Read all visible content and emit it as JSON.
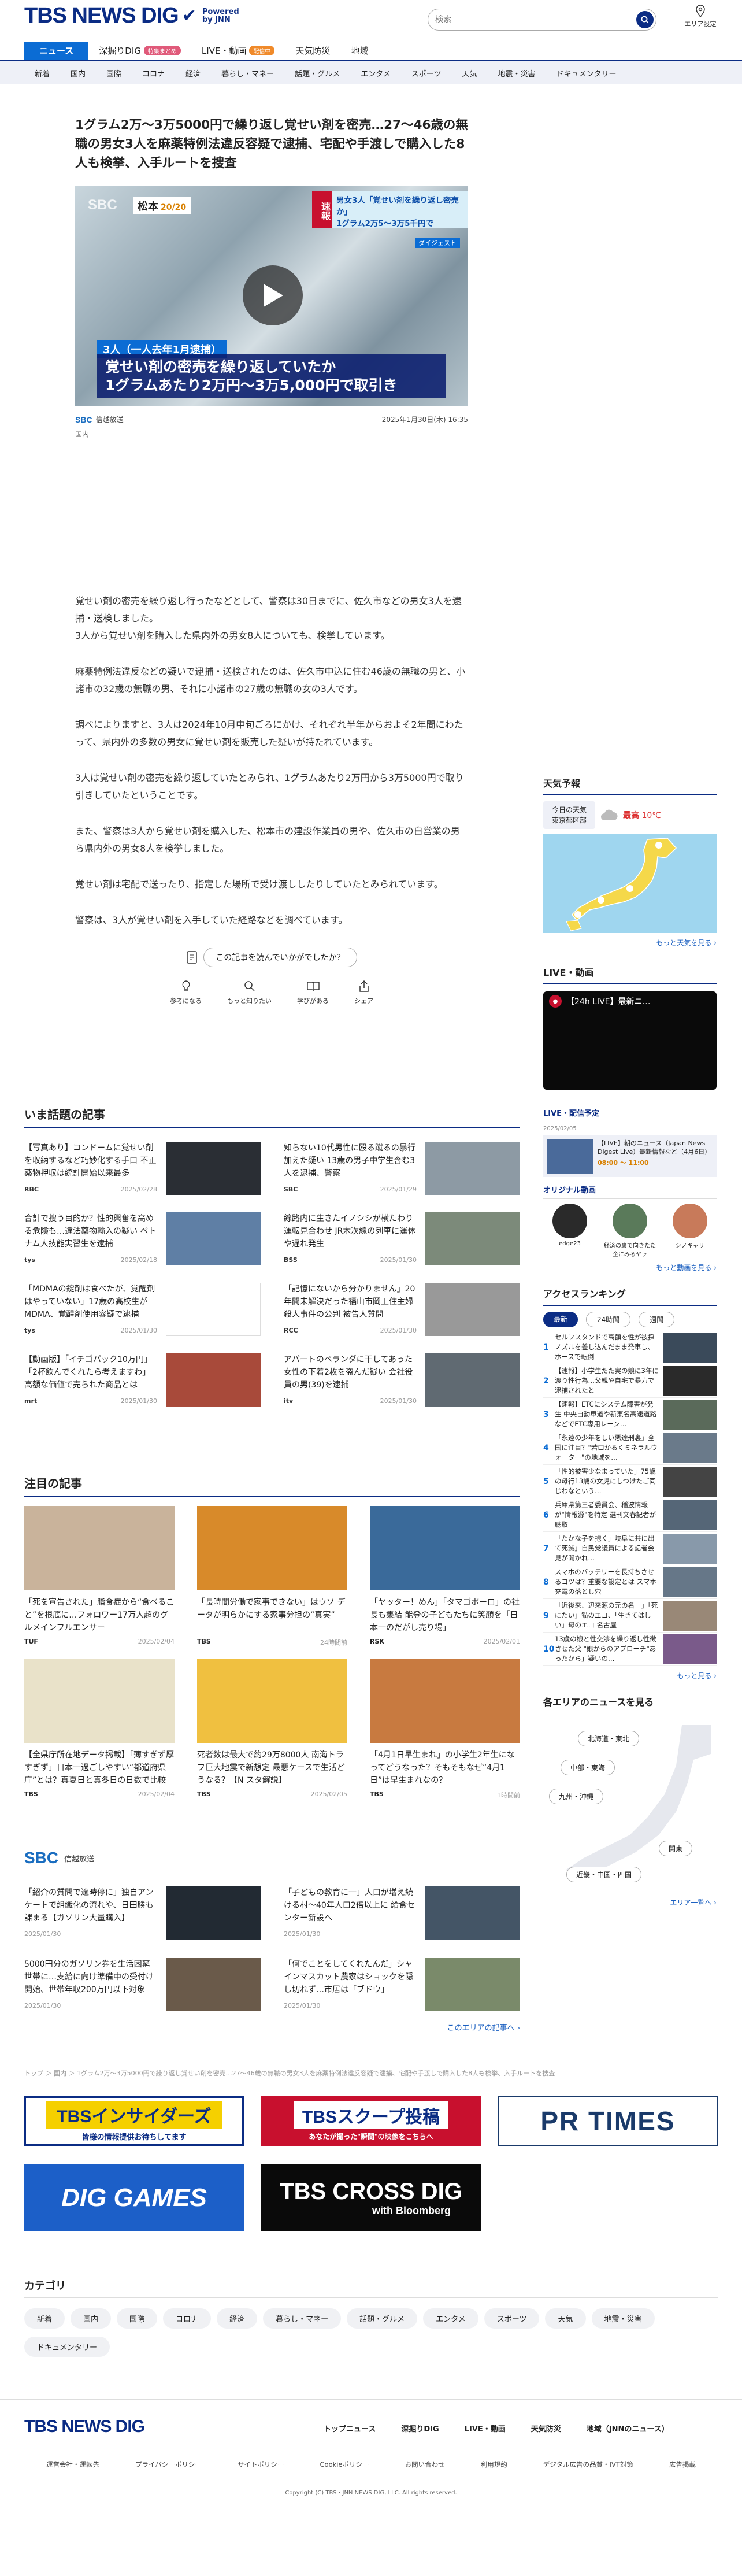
{
  "header": {
    "logo_text": "TBS NEWS DIG",
    "powered": "Powered by JNN",
    "search_placeholder": "検索",
    "area_label": "エリア設定"
  },
  "gnav": [
    {
      "label": "ニュース",
      "active": true
    },
    {
      "label": "深掘りDIG",
      "badge": "特集まとめ"
    },
    {
      "label": "LIVE・動画",
      "badge": "配信中"
    },
    {
      "label": "天気防災"
    },
    {
      "label": "地域"
    }
  ],
  "subnav": [
    "新着",
    "国内",
    "国際",
    "コロナ",
    "経済",
    "暮らし・マネー",
    "話題・グルメ",
    "エンタメ",
    "スポーツ",
    "天気",
    "地震・災害",
    "ドキュメンタリー"
  ],
  "article": {
    "title": "1グラム2万～3万5000円で繰り返し覚せい剤を密売…27～46歳の無職の男女3人を麻薬特例法違反容疑で逮捕、宅配や手渡しで購入した8人も検挙、入手ルートを捜査",
    "video": {
      "sbc": "SBC",
      "place": "松本",
      "time": "20/20",
      "tel_label": "速報",
      "tel_text1": "男女3人「覚せい剤を繰り返し密売か」",
      "tel_text2": "1グラム2万5～3万5千円で",
      "sub": "ダイジェスト",
      "cap1": "3人（一人去年1月逮捕）",
      "cap2_l1": "覚せい剤の密売を繰り返していたか",
      "cap2_l2": "1グラムあたり2万円～3万5,000円で取引き"
    },
    "source": "信越放送",
    "source_mark": "SBC",
    "date": "2025年1月30日(木) 16:35",
    "region": "国内",
    "body": [
      "覚せい剤の密売を繰り返し行ったなどとして、警察は30日までに、佐久市などの男女3人を逮捕・送検しました。\n3人から覚せい剤を購入した県内外の男女8人についても、検挙しています。",
      "麻薬特例法違反などの疑いで逮捕・送検されたのは、佐久市中込に住む46歳の無職の男と、小諸市の32歳の無職の男、それに小諸市の27歳の無職の女の3人です。",
      "調べによりますと、3人は2024年10月中旬ごろにかけ、それぞれ半年からおよそ2年間にわたって、県内外の多数の男女に覚せい剤を販売した疑いが持たれています。",
      "3人は覚せい剤の密売を繰り返していたとみられ、1グラムあたり2万円から3万5000円で取り引きしていたということです。",
      "また、警察は3人から覚せい剤を購入した、松本市の建設作業員の男や、佐久市の自営業の男ら県内外の男女8人を検挙しました。",
      "覚せい剤は宅配で送ったり、指定した場所で受け渡ししたりしていたとみられています。",
      "警察は、3人が覚せい剤を入手していた経路などを調べています。"
    ],
    "read_question": "この記事を読んでいかがでしたか？",
    "reactions": [
      "参考になる",
      "もっと知りたい",
      "学びがある",
      "シェア"
    ]
  },
  "trending": {
    "title": "いま話題の記事",
    "items": [
      {
        "title": "【写真あり】コンドームに覚せい剤を収納するなど巧妙化する手口 不正薬物押収は統計開始以来最多",
        "src": "RBC",
        "date": "2025/02/28",
        "thumb": "#2a2e34"
      },
      {
        "title": "知らない10代男性に殴る蹴るの暴行 加えた疑い 13歳の男子中学生含む3人を逮捕、警察",
        "src": "SBC",
        "date": "2025/01/29",
        "thumb": "#8d9aa4"
      },
      {
        "title": "合計で捜う目的か？性的興奮を高める危険も…違法薬物輸入の疑い ベトナム人技能実習生を逮捕",
        "src": "tys",
        "date": "2025/02/18",
        "thumb": "#5f7fa5"
      },
      {
        "title": "線路内に生きたイノシシが横たわり運転見合わせ JR木次線の列車に運休や遅れ発生",
        "src": "BSS",
        "date": "2025/01/30",
        "thumb": "#7c8a7a"
      },
      {
        "title": "「MDMAの錠剤は食べたが、覚醒剤はやっていない」17歳の高校生がMDMA、覚醒剤使用容疑で逮捕",
        "src": "tys",
        "date": "2025/01/30",
        "thumb": "#ffffff"
      },
      {
        "title": "「記憶にないから分かりません」20年間未解決だった福山市岡王住主婦殺人事件の公判 被告人質問",
        "src": "RCC",
        "date": "2025/01/30",
        "thumb": "#999999"
      },
      {
        "title": "【動画版】「イチゴパック10万円」「2杯飲んでくれたら考えますわ」高額な価値で売られた商品とは",
        "src": "mrt",
        "date": "2025/01/30",
        "thumb": "#a84a3a"
      },
      {
        "title": "アパートのベランダに干してあった女性の下着2枚を盗んだ疑い 会社役員の男(39)を逮捕",
        "src": "itv",
        "date": "2025/01/30",
        "thumb": "#606a72"
      }
    ]
  },
  "featured": {
    "title": "注目の記事",
    "items": [
      {
        "title": "「死を宣告された」脂食症から“食べること”を根底に…フォロワー17万人超のグルメインフルエンサー",
        "src": "TUF",
        "date": "2025/02/04",
        "thumb": "#c9b39b"
      },
      {
        "title": "「長時間労働で家事できない」はウソ データが明らかにする家事分担の“真実”",
        "src": "TBS",
        "date": "24時間前",
        "thumb": "#d88a2a"
      },
      {
        "title": "「ヤッター！めん」「タマゴボーロ」の社長も集結 能登の子どもたちに笑顔を「日本一のだがし売り場」",
        "src": "RSK",
        "date": "2025/02/01",
        "thumb": "#3a6a9a"
      },
      {
        "title": "【全県庁所在地データ掲載】「薄すぎず厚すぎず」日本一過ごしやすい“都道府県庁”とは？真夏日と真冬日の日数で比較",
        "src": "TBS",
        "date": "2025/02/04",
        "thumb": "#e9e2c9"
      },
      {
        "title": "死者数は最大で約29万8000人 南海トラフ巨大地震で新想定 最悪ケースで生活どうなる？【N スタ解説】",
        "src": "TBS",
        "date": "2025/02/05",
        "thumb": "#f0c040"
      },
      {
        "title": "「4月1日早生まれ」の小学生2年生になってどうなった？そもそもなぜ“4月1日”は早生まれなの？",
        "src": "TBS",
        "date": "1時間前",
        "thumb": "#c87a40"
      }
    ]
  },
  "local": {
    "mark": "SBC",
    "name": "信越放送",
    "items": [
      {
        "title": "「紹介の質問で適時停に」独自アンケートで組織化の流れや、日田勝も 課まる【ガソリン大量購入】",
        "date": "2025/01/30",
        "thumb": "#222a33"
      },
      {
        "title": "「子どもの教育に一」人口が増え続ける村～40年人口2倍以上に 給食センター新設へ",
        "date": "2025/01/30",
        "thumb": "#445566"
      },
      {
        "title": "5000円分のガソリン券を生活困窮世帯に…支給に向け準備中の受付け開始、世帯年収200万円以下対象",
        "date": "2025/01/30",
        "thumb": "#6a5a4a"
      },
      {
        "title": "「何でことをしてくれたんだ」シャインマスカット農家はショックを隠し切れず…市居は「ブドウ」",
        "date": "2025/01/30",
        "thumb": "#7a8a6a"
      }
    ],
    "more": "このエリアの記事へ ›"
  },
  "breadcrumb": "トップ ＞ 国内 ＞ 1グラム2万～3万5000円で繰り返し覚せい剤を密売…27～46歳の無職の男女3人を麻薬特例法違反容疑で逮捕、宅配や手渡しで購入した8人も検挙、入手ルートを捜査",
  "banners": {
    "insiders_title": "TBSインサイダーズ",
    "insiders_sub": "皆様の情報提供お待ちしてます",
    "scoop_title": "TBSスクープ投稿",
    "scoop_sub": "あなたが撮った\"瞬間\"の映像をこちらへ",
    "prtimes": "PR TIMES",
    "dig_games": "DIG GAMES",
    "crossdig": "TBS CROSS DIG",
    "crossdig_sub": "with Bloomberg"
  },
  "categories": {
    "title": "カテゴリ",
    "items": [
      "新着",
      "国内",
      "国際",
      "コロナ",
      "経済",
      "暮らし・マネー",
      "話題・グルメ",
      "エンタメ",
      "スポーツ",
      "天気",
      "地震・災害",
      "ドキュメンタリー"
    ]
  },
  "footer": {
    "logo": "TBS NEWS DIG",
    "nav": [
      "トップニュース",
      "深掘りDIG",
      "LIVE・動画",
      "天気防災",
      "地域（JNNのニュース）"
    ],
    "links": [
      "運営会社・運転先",
      "プライバシーポリシー",
      "サイトポリシー",
      "Cookieポリシー",
      "お問い合わせ",
      "利用規約",
      "デジタル広告の品質・IVT対策",
      "広告掲載"
    ],
    "copyright": "Copyright (C) TBS・JNN NEWS DIG, LLC. All rights reserved."
  },
  "sidebar": {
    "weather_title": "天気予報",
    "weather_loc1": "今日の天気",
    "weather_loc2": "東京都区部",
    "weather_hi_label": "最高",
    "weather_hi": "10℃",
    "weather_more": "もっと天気を見る ›",
    "live_title": "LIVE・動画",
    "live_video_title": "【24h LIVE】最新ニ…",
    "live_sched_title": "LIVE・配信予定",
    "live_sched_date": "2025/02/05",
    "live_sched_item": "【LIVE】朝のニュース（Japan News Digest Live）最新情報など（4月6日）",
    "live_sched_time": "08:00 ～ 11:00",
    "original_title": "オリジナル動画",
    "originals": [
      "edge23",
      "経済の裏で向きたた企にみるヤッ",
      "シノキャリ"
    ],
    "videos_more": "もっと動画を見る ›",
    "ranking_title": "アクセスランキング",
    "ranking_tabs": [
      "最新",
      "24時間",
      "週間"
    ],
    "ranking": [
      "セルフスタンドで高額を性が被採ノズルを差し込んだまま発車し、ホースで転倒",
      "【速報】小学生たた実の娘に3年に渡り性行為…父親や自宅で暴力で逮捕されたと",
      "【速報】ETCにシステム障害が発生 中央自動車道や新東名高速道路などでETC専用レーン…",
      "「永遠の少年をしい悪達刑裏」全国に注目？\"若口かるくミネラルウォーター\"の地域を…",
      "「性的被害少なまっていた」75歳の母行13歳の女児にしつけたご同じわなという…",
      "兵庫県第三者委員会、稲波情報が\"情報源\"を特定 選刊文春記者が聴取",
      "「たかな子を抱く」岐阜に共に出て死滅」自民党議員による記者会見が開かれ…",
      "スマホのバッテリーを長持ちさせるコツは？重要な設定とは スマホ充電の落とし穴",
      "「近後来、辺来源の元の名一」「死にたい」猫のエコ、「生きてはしい」母のエコ 名古屋",
      "13歳の娘と性交渉を繰り返し性徴させた父 \"娘からのアプローチ\"あったから」疑いの…"
    ],
    "ranking_more": "もっと見る ›",
    "area_title": "各エリアのニュースを見る",
    "areas": [
      "北海道・東北",
      "中部・東海",
      "九州・沖縄",
      "関東",
      "近畿・中国・四国"
    ],
    "area_more": "エリア一覧へ ›"
  },
  "colors": {
    "brand": "#0b2c84",
    "accent": "#0b6cd4",
    "badge_pink": "#e05a7a",
    "badge_orange": "#f08a2a"
  }
}
